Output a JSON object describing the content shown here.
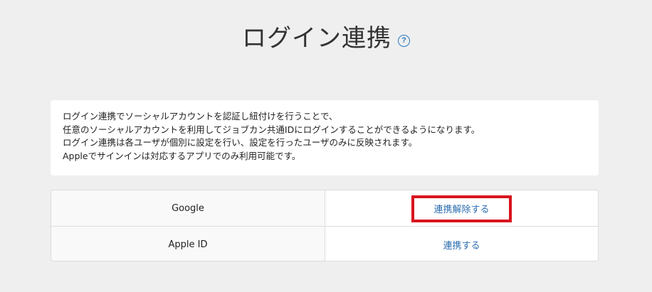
{
  "page": {
    "title": "ログイン連携",
    "help_icon": "question-circle-icon"
  },
  "info": {
    "lines": [
      "ログイン連携でソーシャルアカウントを認証し紐付けを行うことで、",
      "任意のソーシャルアカウントを利用してジョブカン共通IDにログインすることができるようになります。",
      "ログイン連携は各ユーザが個別に設定を行い、設定を行ったユーザのみに反映されます。",
      "Appleでサインインは対応するアプリでのみ利用可能です。"
    ]
  },
  "providers": [
    {
      "name": "Google",
      "action_label": "連携解除する",
      "linked": true,
      "highlighted": true
    },
    {
      "name": "Apple ID",
      "action_label": "連携する",
      "linked": false,
      "highlighted": false
    }
  ],
  "colors": {
    "link": "#2b6cb0",
    "highlight_border": "#d9141e",
    "background": "#efefef"
  }
}
